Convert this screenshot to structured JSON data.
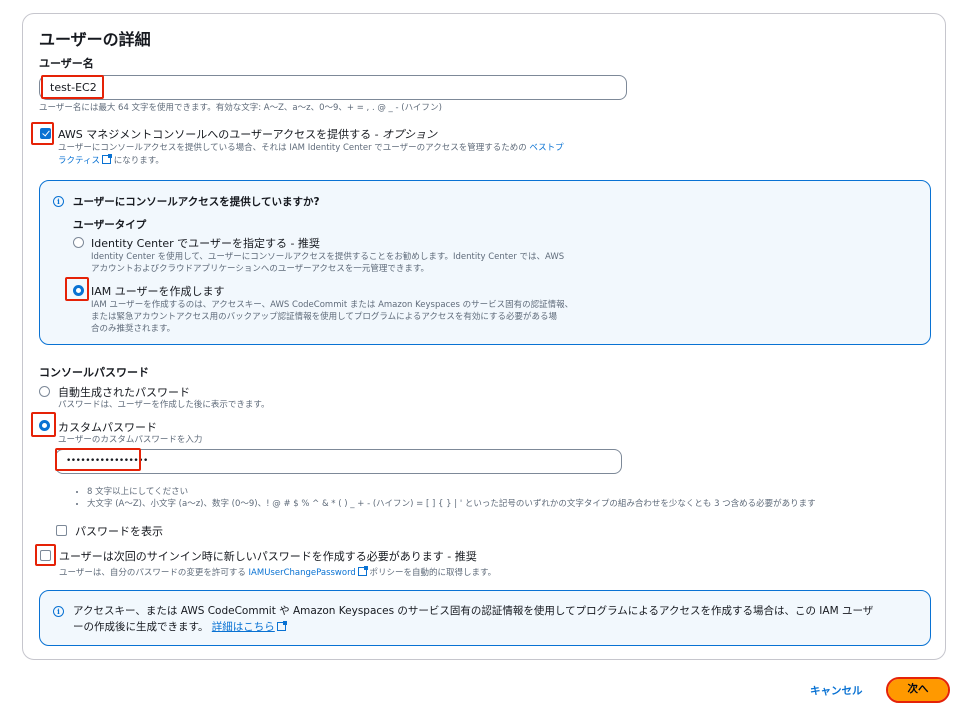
{
  "section": {
    "title": "ユーザーの詳細"
  },
  "username": {
    "label": "ユーザー名",
    "value": "test-EC2",
    "hint": "ユーザー名には最大 64 文字を使用できます。有効な文字: A〜Z、a〜z、0〜9、+ = , . @ _ - (ハイフン)"
  },
  "console_access": {
    "label": "AWS マネジメントコンソールへのユーザーアクセスを提供する - ",
    "label_optional": "オプション",
    "desc_pre": "ユーザーにコンソールアクセスを提供している場合、それは IAM Identity Center でユーザーのアクセスを管理するための ",
    "desc_link_line1": "ベストプ",
    "desc_link_line2": "ラクティス",
    "desc_post": "になります。",
    "checked": true
  },
  "info_box": {
    "question": "ユーザーにコンソールアクセスを提供していますか?",
    "user_type_label": "ユーザータイプ",
    "option1_label": "Identity Center でユーザーを指定する - 推奨",
    "option1_desc_line1": "Identity Center を使用して、ユーザーにコンソールアクセスを提供することをお勧めします。Identity Center では、AWS",
    "option1_desc_line2": "アカウントおよびクラウドアプリケーションへのユーザーアクセスを一元管理できます。",
    "option2_label": "IAM ユーザーを作成します",
    "option2_desc_line1": "IAM ユーザーを作成するのは、アクセスキー、AWS CodeCommit または Amazon Keyspaces のサービス固有の認証情報、",
    "option2_desc_line2": "または緊急アカウントアクセス用のバックアップ認証情報を使用してプログラムによるアクセスを有効にする必要がある場",
    "option2_desc_line3": "合のみ推奨されます。",
    "selected": "option2"
  },
  "password": {
    "label": "コンソールパスワード",
    "auto_label": "自動生成されたパスワード",
    "auto_desc": "パスワードは、ユーザーを作成した後に表示できます。",
    "custom_label": "カスタムパスワード",
    "custom_desc": "ユーザーのカスタムパスワードを入力",
    "value": "•••••••••••••••••",
    "selected": "custom",
    "req1": "8 文字以上にしてください",
    "req2": "大文字 (A〜Z)、小文字 (a〜z)、数字 (0〜9)、! @ # $ % ^ & * ( ) _ + - (ハイフン) = [ ] { } | ' といった記号のいずれかの文字タイプの組み合わせを少なくとも 3 つ含める必要があります",
    "show_label": "パスワードを表示",
    "show_checked": false
  },
  "reset": {
    "label": "ユーザーは次回のサインイン時に新しいパスワードを作成する必要があります - 推奨",
    "desc_pre": "ユーザーは、自分のパスワードの変更を許可する ",
    "desc_link": "IAMUserChangePassword",
    "desc_post": " ポリシーを自動的に取得します。",
    "checked": false
  },
  "bottom_info": {
    "line1": "アクセスキー、または AWS CodeCommit や Amazon Keyspaces のサービス固有の認証情報を使用してプログラムによるアクセスを作成する場合は、この IAM ユーザ",
    "line2": "ーの作成後に生成できます。",
    "link": "詳細はこちら"
  },
  "footer": {
    "cancel": "キャンセル",
    "next": "次へ"
  },
  "colors": {
    "accent": "#0972d3",
    "primary_button": "#ff9900",
    "highlight": "#e52207"
  }
}
